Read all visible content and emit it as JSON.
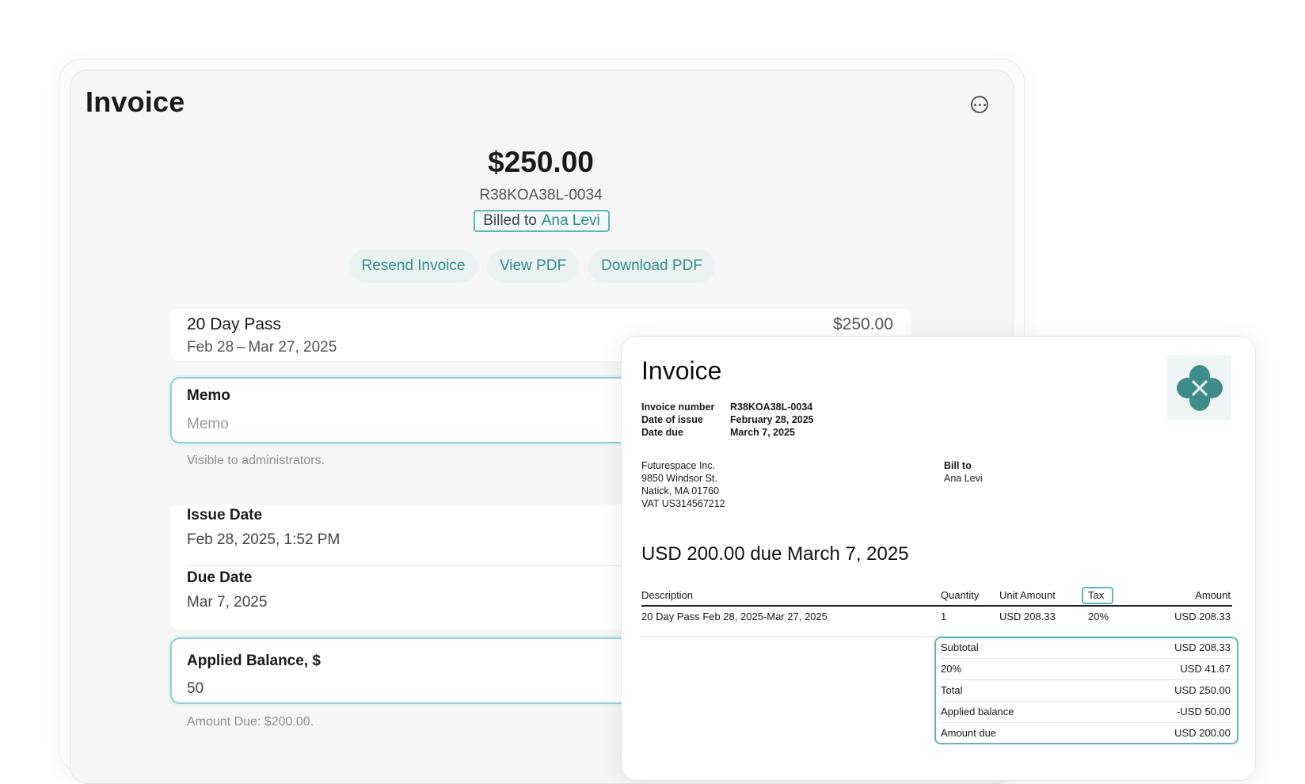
{
  "page": {
    "title": "Invoice",
    "amount": "$250.00",
    "invoice_number": "R38KOA38L-0034",
    "billed_prefix": "Billed to",
    "billed_name": "Ana Levi",
    "actions": {
      "resend": "Resend Invoice",
      "view_pdf": "View PDF",
      "download_pdf": "Download PDF"
    },
    "line_item": {
      "name": "20 Day Pass",
      "dates": "Feb 28 – Mar 27, 2025",
      "price": "$250.00"
    },
    "memo": {
      "label": "Memo",
      "placeholder": "Memo",
      "hint": "Visible to administrators."
    },
    "issue_date": {
      "label": "Issue Date",
      "value": "Feb 28, 2025, 1:52 PM"
    },
    "due_date": {
      "label": "Due Date",
      "value": "Mar 7, 2025"
    },
    "applied_balance": {
      "label": "Applied Balance, $",
      "value": "50",
      "hint": "Amount Due: $200.00."
    },
    "icons": {
      "more": "more-options-icon",
      "logo": "logo-icon"
    },
    "colors": {
      "accent": "#2f8c8c",
      "focus_border": "#8fd0d0",
      "highlight": "#5fb6b6"
    }
  },
  "pdf": {
    "title": "Invoice",
    "meta": [
      {
        "key": "Invoice number",
        "value": "R38KOA38L-0034"
      },
      {
        "key": "Date of issue",
        "value": "February 28, 2025"
      },
      {
        "key": "Date due",
        "value": "March 7, 2025"
      }
    ],
    "from": [
      "Futurespace Inc.",
      "9850 Windsor St.",
      "Natick, MA 01760",
      "VAT US314567212"
    ],
    "bill_to_label": "Bill to",
    "bill_to_name": "Ana Levi",
    "due_line": "USD 200.00 due March 7, 2025",
    "table": {
      "headers": {
        "description": "Description",
        "quantity": "Quantity",
        "unit_amount": "Unit Amount",
        "tax": "Tax",
        "amount": "Amount"
      },
      "rows": [
        {
          "description": "20 Day Pass Feb 28, 2025-Mar 27, 2025",
          "quantity": "1",
          "unit_amount": "USD 208.33",
          "tax": "20%",
          "amount": "USD 208.33"
        }
      ]
    },
    "totals": [
      {
        "label": "Subtotal",
        "value": "USD 208.33"
      },
      {
        "label": "20%",
        "value": "USD 41.67"
      },
      {
        "label": "Total",
        "value": "USD 250.00"
      },
      {
        "label": "Applied balance",
        "value": "-USD 50.00"
      },
      {
        "label": "Amount due",
        "value": "USD 200.00"
      }
    ]
  }
}
